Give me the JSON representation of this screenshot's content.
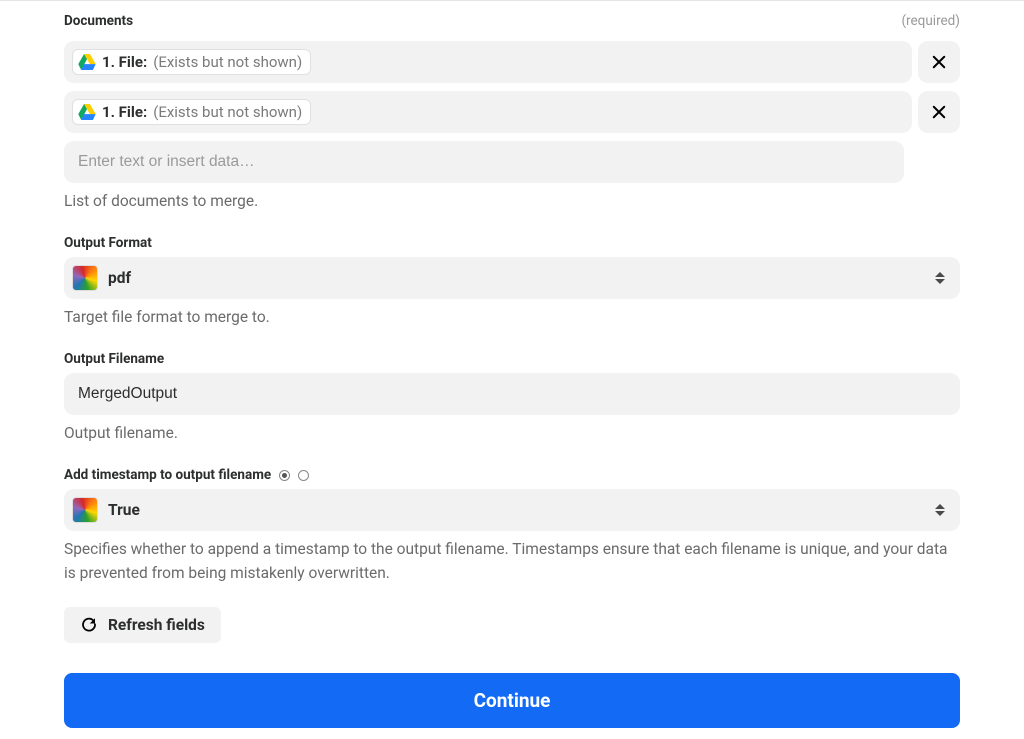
{
  "documents": {
    "label": "Documents",
    "required": "(required)",
    "items": [
      {
        "label": "1. File:",
        "meta": "(Exists but not shown)"
      },
      {
        "label": "1. File:",
        "meta": "(Exists but not shown)"
      }
    ],
    "input_placeholder": "Enter text or insert data…",
    "help": "List of documents to merge."
  },
  "output_format": {
    "label": "Output Format",
    "value": "pdf",
    "help": "Target file format to merge to."
  },
  "output_filename": {
    "label": "Output Filename",
    "value": "MergedOutput",
    "help": "Output filename."
  },
  "timestamp": {
    "label": "Add timestamp to output filename",
    "value": "True",
    "help": "Specifies whether to append a timestamp to the output filename. Timestamps ensure that each filename is unique, and your data is prevented from being mistakenly overwritten."
  },
  "refresh_label": "Refresh fields",
  "continue_label": "Continue"
}
